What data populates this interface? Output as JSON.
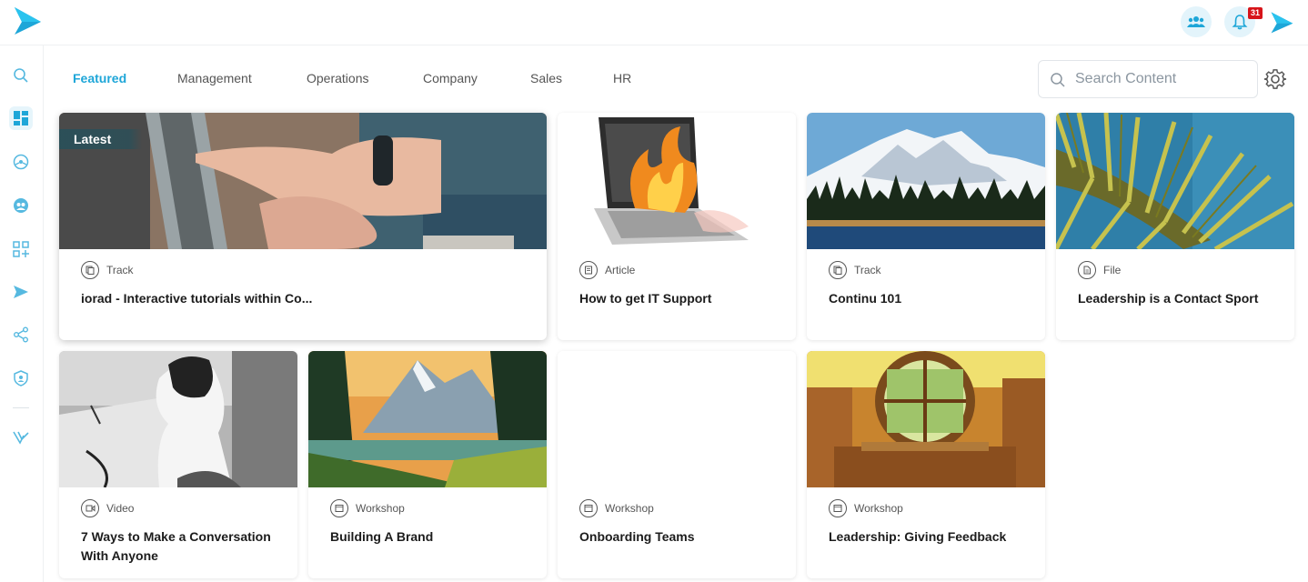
{
  "header": {
    "notification_count": "31",
    "icons": [
      "logo-arrow-icon",
      "team-icon",
      "bell-icon",
      "logo-arrow-icon"
    ]
  },
  "sidebar": {
    "items": [
      "search-icon",
      "dashboard-icon",
      "explore-icon",
      "community-icon",
      "add-apps-icon",
      "send-icon",
      "share-icon",
      "admin-shield-icon",
      "bottom-logo-icon"
    ]
  },
  "tabs": [
    {
      "label": "Featured",
      "active": true
    },
    {
      "label": "Management"
    },
    {
      "label": "Operations"
    },
    {
      "label": "Company"
    },
    {
      "label": "Sales"
    },
    {
      "label": "HR"
    }
  ],
  "search": {
    "placeholder": "Search Content"
  },
  "cards": [
    {
      "badge": "Latest",
      "type": "Track",
      "title": "iorad - Interactive tutorials within Co..."
    },
    {
      "type": "Article",
      "title": "How to get IT Support"
    },
    {
      "type": "Track",
      "title": "Continu 101"
    },
    {
      "type": "File",
      "title": "Leadership is a Contact Sport"
    },
    {
      "type": "Video",
      "title": "7 Ways to Make a Conversation With Anyone"
    },
    {
      "type": "Workshop",
      "title": "Building A Brand"
    },
    {
      "type": "Workshop",
      "title": "Onboarding Teams"
    },
    {
      "type": "Workshop",
      "title": "Leadership: Giving Feedback"
    }
  ],
  "colors": {
    "accent": "#1ea6d8",
    "badge": "#d7141a"
  }
}
